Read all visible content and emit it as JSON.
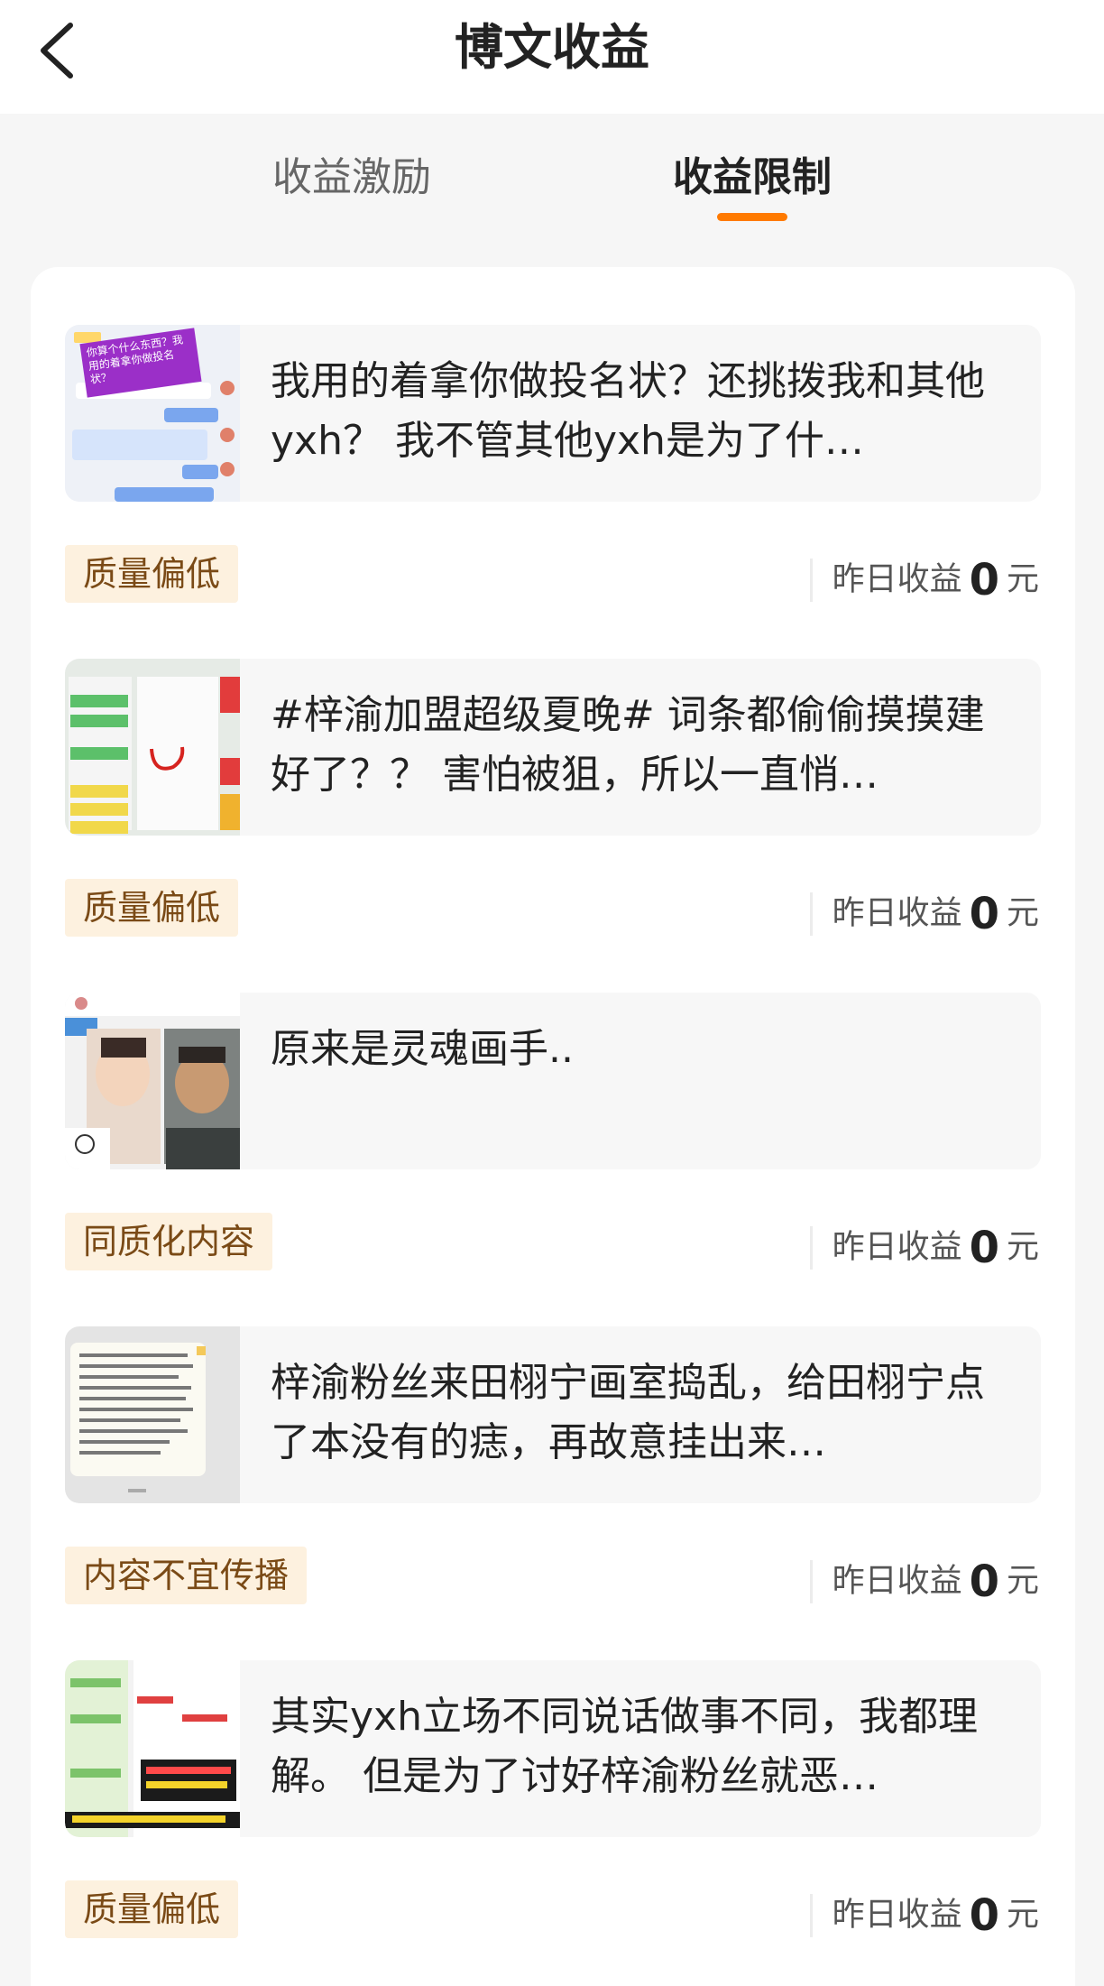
{
  "header": {
    "title": "博文收益",
    "back_icon": "chevron-left-icon"
  },
  "tabs": [
    {
      "label": "收益激励",
      "active": false
    },
    {
      "label": "收益限制",
      "active": true
    }
  ],
  "accent_color": "#ff7a00",
  "posts": [
    {
      "text": "我用的着拿你做投名状？还挑拨我和其他yxh？ 我不管其他yxh是为了什…",
      "tag": "质量偏低",
      "earn_label": "昨日收益",
      "earn_value": "0",
      "earn_unit": "元",
      "thumb_overlay": "你算个什么东西？我用的着拿你做投名状？"
    },
    {
      "text": "#梓渝加盟超级夏晚# 词条都偷偷摸摸建好了？？ 害怕被狙，所以一直悄…",
      "tag": "质量偏低",
      "earn_label": "昨日收益",
      "earn_value": "0",
      "earn_unit": "元"
    },
    {
      "text": "原来是灵魂画手..",
      "tag": "同质化内容",
      "earn_label": "昨日收益",
      "earn_value": "0",
      "earn_unit": "元"
    },
    {
      "text": "梓渝粉丝来田栩宁画室捣乱，给田栩宁点了本没有的痣，再故意挂出来…",
      "tag": "内容不宜传播",
      "earn_label": "昨日收益",
      "earn_value": "0",
      "earn_unit": "元"
    },
    {
      "text": "其实yxh立场不同说话做事不同，我都理解。 但是为了讨好梓渝粉丝就恶…",
      "tag": "质量偏低",
      "earn_label": "昨日收益",
      "earn_value": "0",
      "earn_unit": "元"
    }
  ]
}
